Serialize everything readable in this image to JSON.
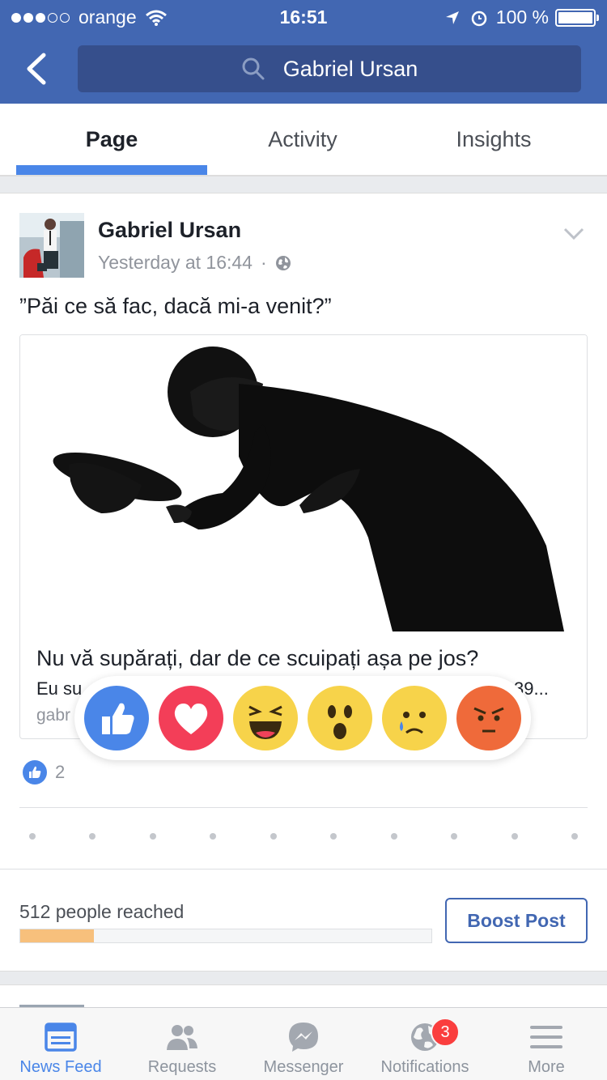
{
  "status_bar": {
    "carrier": "orange",
    "time": "16:51",
    "battery": "100 %"
  },
  "header": {
    "search_text": "Gabriel Ursan"
  },
  "tabs": [
    {
      "label": "Page",
      "active": true
    },
    {
      "label": "Activity",
      "active": false
    },
    {
      "label": "Insights",
      "active": false
    }
  ],
  "post": {
    "author": "Gabriel Ursan",
    "timestamp": "Yesterday at 16:44",
    "separator": "·",
    "text": "”Păi ce să fac, dacă mi-a venit?”",
    "link": {
      "title": "Nu vă supărați, dar de ce scuipați așa pe jos?",
      "description_start": "Eu su",
      "description_end": "39...",
      "domain": "gabr"
    },
    "reactions": [
      "like",
      "love",
      "haha",
      "wow",
      "sad",
      "angry"
    ],
    "like_count": "2"
  },
  "insights": {
    "reached": "512 people reached",
    "progress_fraction": 0.18,
    "boost_label": "Boost Post"
  },
  "bottom_nav": [
    {
      "label": "News Feed",
      "icon": "news-feed-icon",
      "active": true
    },
    {
      "label": "Requests",
      "icon": "friend-requests-icon",
      "active": false
    },
    {
      "label": "Messenger",
      "icon": "messenger-icon",
      "active": false
    },
    {
      "label": "Notifications",
      "icon": "globe-icon",
      "active": false,
      "badge": "3"
    },
    {
      "label": "More",
      "icon": "menu-icon",
      "active": false
    }
  ],
  "colors": {
    "brand": "#4267b2",
    "accent": "#4a86e8",
    "badge": "#fa3e3e",
    "progress": "#f7c07c"
  }
}
